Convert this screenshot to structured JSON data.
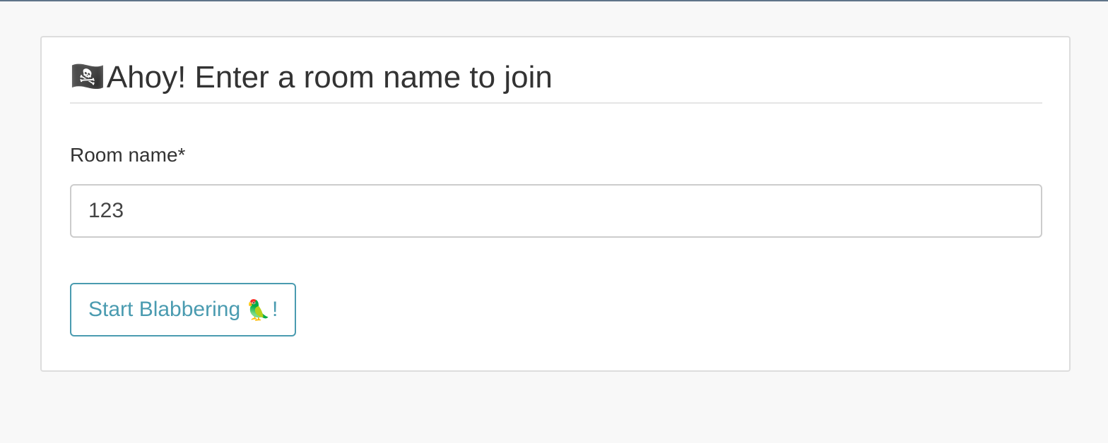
{
  "form": {
    "flag_icon": "🏴‍☠️",
    "heading": "Ahoy! Enter a room name to join",
    "room_label": "Room name*",
    "room_value": "123",
    "button_label": "Start Blabbering ",
    "button_parrot": "🦜",
    "button_suffix": "!"
  },
  "colors": {
    "accent": "#4a9bb0",
    "text": "#333333",
    "background": "#f8f8f8",
    "panel": "#ffffff",
    "border": "#dddddd"
  }
}
